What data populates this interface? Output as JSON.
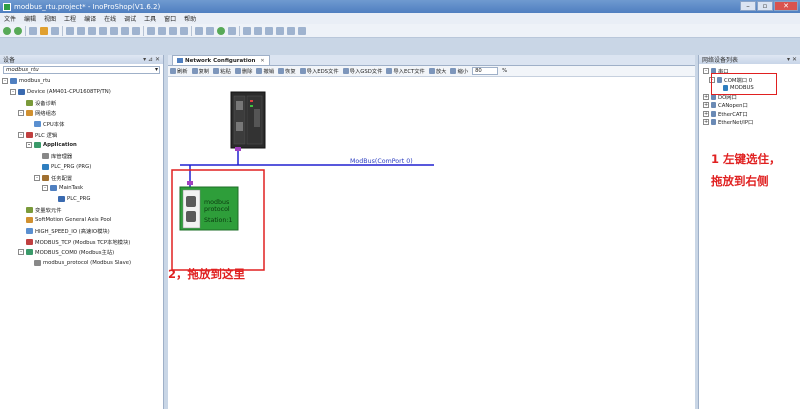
{
  "window": {
    "title": "modbus_rtu.project* - InoProShop(V1.6.2)"
  },
  "menu": [
    "文件",
    "编辑",
    "视图",
    "工程",
    "编译",
    "在线",
    "调试",
    "工具",
    "窗口",
    "帮助"
  ],
  "left_panel": {
    "title": "设备",
    "project_dropdown": "modbus_rtu",
    "tree": [
      {
        "label": "modbus_rtu",
        "level": 0,
        "expander": "-"
      },
      {
        "label": "Device (AM401-CPU1608TP/TN)",
        "level": 1,
        "expander": "-"
      },
      {
        "label": "设备诊断",
        "level": 2,
        "expander": ""
      },
      {
        "label": "网络组态",
        "level": 2,
        "expander": "-"
      },
      {
        "label": "CPU本体",
        "level": 3,
        "expander": ""
      },
      {
        "label": "PLC 逻辑",
        "level": 2,
        "expander": "-"
      },
      {
        "label": "Application",
        "level": 3,
        "expander": "-",
        "bold": true
      },
      {
        "label": "库管理器",
        "level": 4,
        "expander": ""
      },
      {
        "label": "PLC_PRG (PRG)",
        "level": 4,
        "expander": ""
      },
      {
        "label": "任务配置",
        "level": 4,
        "expander": "-"
      },
      {
        "label": "MainTask",
        "level": 5,
        "expander": "-"
      },
      {
        "label": "PLC_PRG",
        "level": 6,
        "expander": ""
      },
      {
        "label": "变量软元件",
        "level": 2,
        "expander": ""
      },
      {
        "label": "SoftMotion General Axis Pool",
        "level": 2,
        "expander": ""
      },
      {
        "label": "HIGH_SPEED_IO (高速IO模块)",
        "level": 2,
        "expander": ""
      },
      {
        "label": "MODBUS_TCP (Modbus TCP本地模块)",
        "level": 2,
        "expander": ""
      },
      {
        "label": "MODBUS_COM0 (Modbus主站)",
        "level": 2,
        "expander": "-"
      },
      {
        "label": "modbus_protocol (Modbus Slave)",
        "level": 3,
        "expander": ""
      }
    ]
  },
  "editor": {
    "tab_label": "Network Configuration",
    "toolbar": [
      "刷新",
      "复制",
      "粘贴",
      "删除",
      "撤销",
      "恢复",
      "导入EDS文件",
      "导入GSD文件",
      "导入ECT文件",
      "放大",
      "缩小"
    ],
    "zoom_value": "80",
    "zoom_unit": "%",
    "bus_label": "ModBus(ComPort 0)",
    "slave_block": {
      "line1": "modbus",
      "line2": "protocol",
      "line3": "Station:1"
    }
  },
  "right_panel": {
    "title": "网络设备列表",
    "tree": [
      {
        "label": "串口",
        "level": 0,
        "expander": "-"
      },
      {
        "label": "COM端口 0",
        "level": 1,
        "expander": "-"
      },
      {
        "label": "MODBUS",
        "level": 2,
        "expander": ""
      },
      {
        "label": "DO网口",
        "level": 0,
        "expander": "+"
      },
      {
        "label": "CANopen口",
        "level": 0,
        "expander": "+"
      },
      {
        "label": "EtherCAT口",
        "level": 0,
        "expander": "+"
      },
      {
        "label": "EtherNet/IP口",
        "level": 0,
        "expander": "+"
      }
    ]
  },
  "annotations": {
    "note1_line1": "1 左键选住，",
    "note1_line2": "拖放到右侧",
    "note2": "2，拖放到这里"
  },
  "colors": {
    "annotation_red": "#e02020",
    "bus_blue": "#2020d0",
    "slave_green": "#2e9e3a"
  }
}
